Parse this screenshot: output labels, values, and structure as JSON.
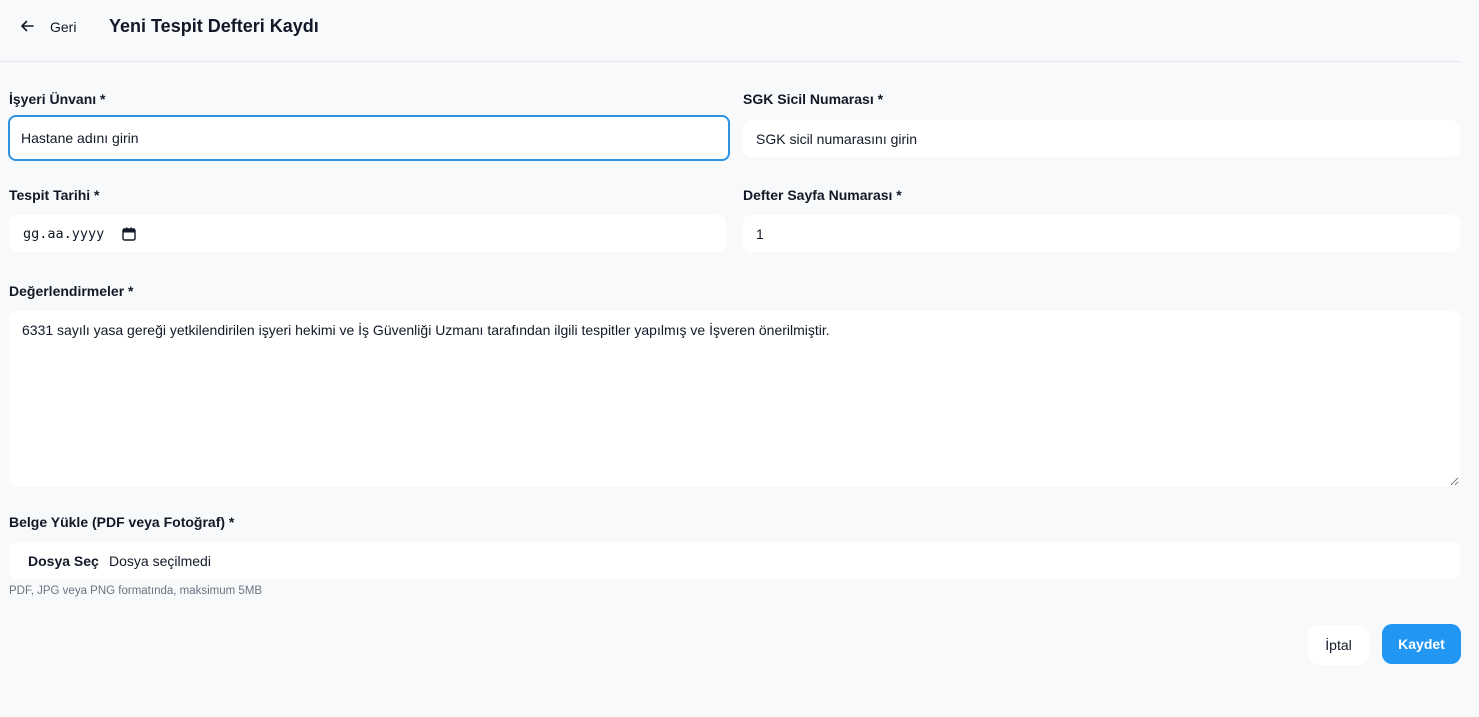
{
  "header": {
    "back_label": "Geri",
    "title": "Yeni Tespit Defteri Kaydı"
  },
  "form": {
    "workplace_label": "İşyeri Ünvanı *",
    "workplace_placeholder": "Hastane adını girin",
    "sgk_label": "SGK Sicil Numarası *",
    "sgk_placeholder": "SGK sicil numarasını girin",
    "date_label": "Tespit Tarihi *",
    "date_placeholder": "gg.aa.yyyy",
    "page_label": "Defter Sayfa Numarası *",
    "page_value": "1",
    "evaluation_label": "Değerlendirmeler *",
    "evaluation_value": "6331 sayılı yasa gereği yetkilendirilen işyeri hekimi ve İş Güvenliği Uzmanı tarafından ilgili tespitler yapılmış ve İşveren önerilmiştir.",
    "upload_label": "Belge Yükle (PDF veya Fotoğraf) *",
    "upload_button": "Dosya Seç",
    "upload_status": "Dosya seçilmedi",
    "upload_hint": "PDF, JPG veya PNG formatında, maksimum 5MB"
  },
  "actions": {
    "cancel_label": "İptal",
    "save_label": "Kaydet"
  },
  "colors": {
    "accent": "#2196f3",
    "focus_border": "#2b93e6",
    "background": "#f8f9fb"
  },
  "icons": {
    "back": "arrow-left-icon",
    "calendar": "calendar-icon"
  }
}
